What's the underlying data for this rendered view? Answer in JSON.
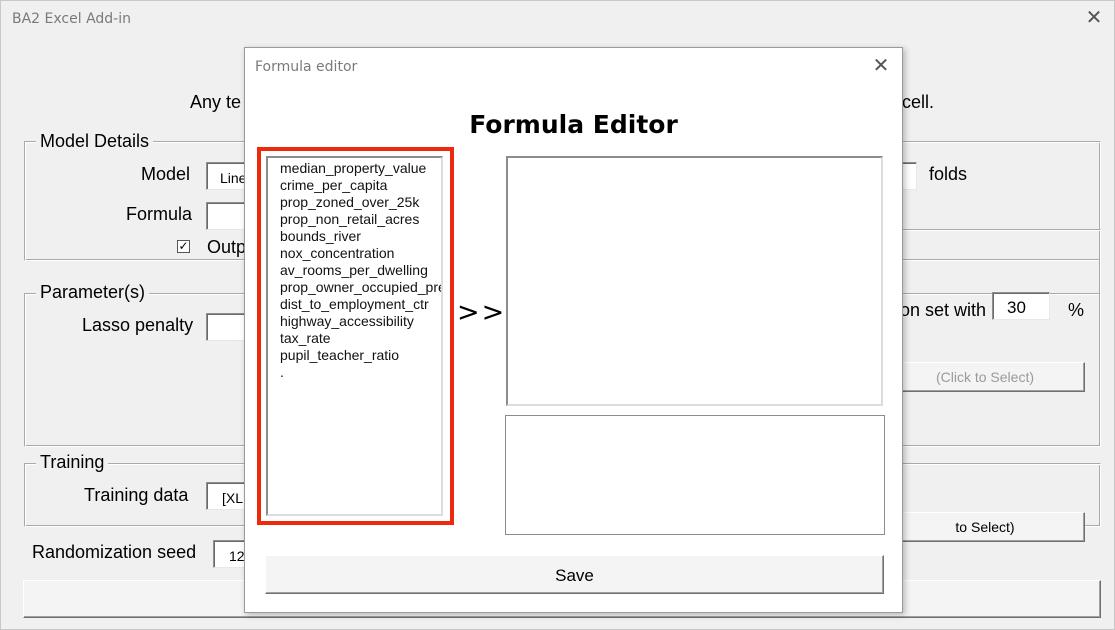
{
  "main_window": {
    "title": "BA2 Excel Add-in",
    "intro_left": "Any te",
    "intro_right": "cell.",
    "model_details": {
      "legend": "Model Details",
      "model_label": "Model",
      "model_value": "Line",
      "formula_label": "Formula",
      "output_checkbox_label": "Outp",
      "output_checked": true,
      "folds_label": "folds"
    },
    "parameters": {
      "legend": "Parameter(s)",
      "lasso_label": "Lasso penalty",
      "validation_label": "on set with",
      "validation_value": "30",
      "percent": "%",
      "select1": "(Click to Select)"
    },
    "training": {
      "legend": "Training",
      "training_data_label": "Training data",
      "training_data_value": "[XL",
      "select2": "to Select)"
    },
    "seed_label": "Randomization seed",
    "seed_value": "12"
  },
  "dialog": {
    "title": "Formula editor",
    "heading": "Formula Editor",
    "variables": [
      "median_property_value",
      "crime_per_capita",
      "prop_zoned_over_25k",
      "prop_non_retail_acres",
      "bounds_river",
      "nox_concentration",
      "av_rooms_per_dwelling",
      "prop_owner_occupied_pre",
      "dist_to_employment_ctr",
      "highway_accessibility",
      "tax_rate",
      "pupil_teacher_ratio",
      "."
    ],
    "arrow": ">>",
    "save_label": "Save"
  },
  "colors": {
    "highlight": "#ee2a0e"
  },
  "icons": {
    "close": "close-icon",
    "check": "checkmark-icon"
  }
}
